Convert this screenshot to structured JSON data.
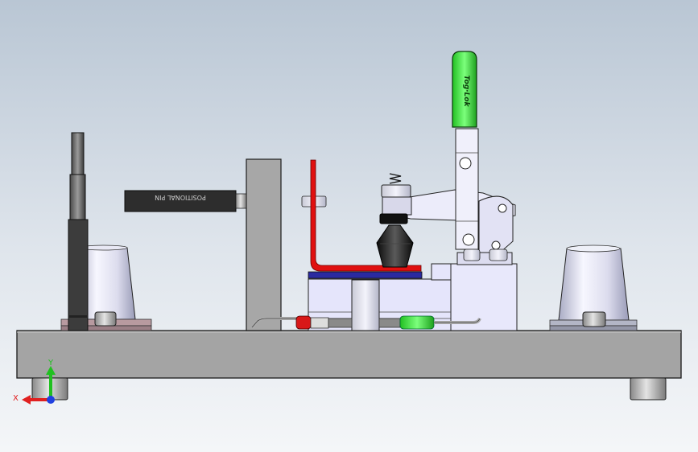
{
  "viewport": {
    "background_top": "#b9c6d4",
    "background_bottom": "#f4f6f8"
  },
  "parts": {
    "positional_pin_label": "POSITIONAL PIN",
    "clamp_handle_brand": "Tog·Lok",
    "handle_color": "#39e639",
    "part_outline_color": "#e01010",
    "locator_plate_color": "#2a2aa0"
  },
  "triad": {
    "x_label": "X",
    "y_label": "Y",
    "x_color": "#e02020",
    "y_color": "#20c020",
    "z_color": "#2040e0"
  }
}
